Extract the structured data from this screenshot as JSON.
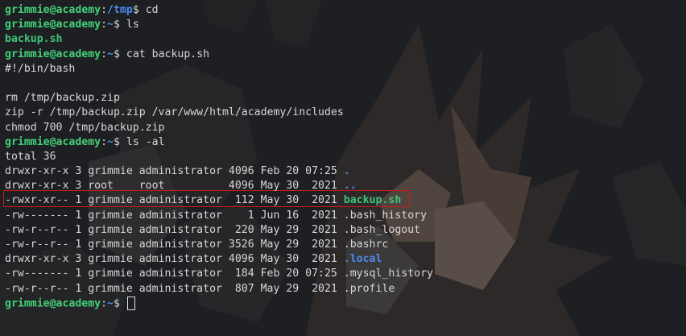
{
  "prompt": {
    "user": "grimmie@academy",
    "sep": ":",
    "end": "$ "
  },
  "lines": [
    {
      "path": "/tmp",
      "cmd": "cd"
    },
    {
      "path": "~",
      "cmd": "ls"
    },
    {
      "output": "backup.sh"
    },
    {
      "path": "~",
      "cmd": "cat backup.sh"
    },
    {
      "output": "#!/bin/bash"
    },
    {
      "output": ""
    },
    {
      "output": "rm /tmp/backup.zip"
    },
    {
      "output": "zip -r /tmp/backup.zip /var/www/html/academy/includes"
    },
    {
      "output": "chmod 700 /tmp/backup.zip"
    },
    {
      "path": "~",
      "cmd": "ls -al"
    },
    {
      "output": "total 36"
    }
  ],
  "listing": [
    {
      "meta": "drwxr-xr-x 3 grimmie administrator 4096 Feb 20 07:25 ",
      "name": "."
    },
    {
      "meta": "drwxr-xr-x 3 root    root          4096 May 30  2021 ",
      "name": ".."
    },
    {
      "meta": "-rwxr-xr-- 1 grimmie administrator  112 May 30  2021 ",
      "name": "backup.sh"
    },
    {
      "meta": "-rw------- 1 grimmie administrator    1 Jun 16  2021 ",
      "name": ".bash_history"
    },
    {
      "meta": "-rw-r--r-- 1 grimmie administrator  220 May 29  2021 ",
      "name": ".bash_logout"
    },
    {
      "meta": "-rw-r--r-- 1 grimmie administrator 3526 May 29  2021 ",
      "name": ".bashrc"
    },
    {
      "meta": "drwxr-xr-x 3 grimmie administrator 4096 May 30  2021 ",
      "name": ".local"
    },
    {
      "meta": "-rw------- 1 grimmie administrator  184 Feb 20 07:25 ",
      "name": ".mysql_history"
    },
    {
      "meta": "-rw-r--r-- 1 grimmie administrator  807 May 29  2021 ",
      "name": ".profile"
    }
  ],
  "final_prompt_path": "~",
  "colors": {
    "background": "#1e1f22",
    "user": "#44d27a",
    "path": "#4a8cf0",
    "executable": "#3fc47a",
    "highlight_box": "#d01818"
  }
}
